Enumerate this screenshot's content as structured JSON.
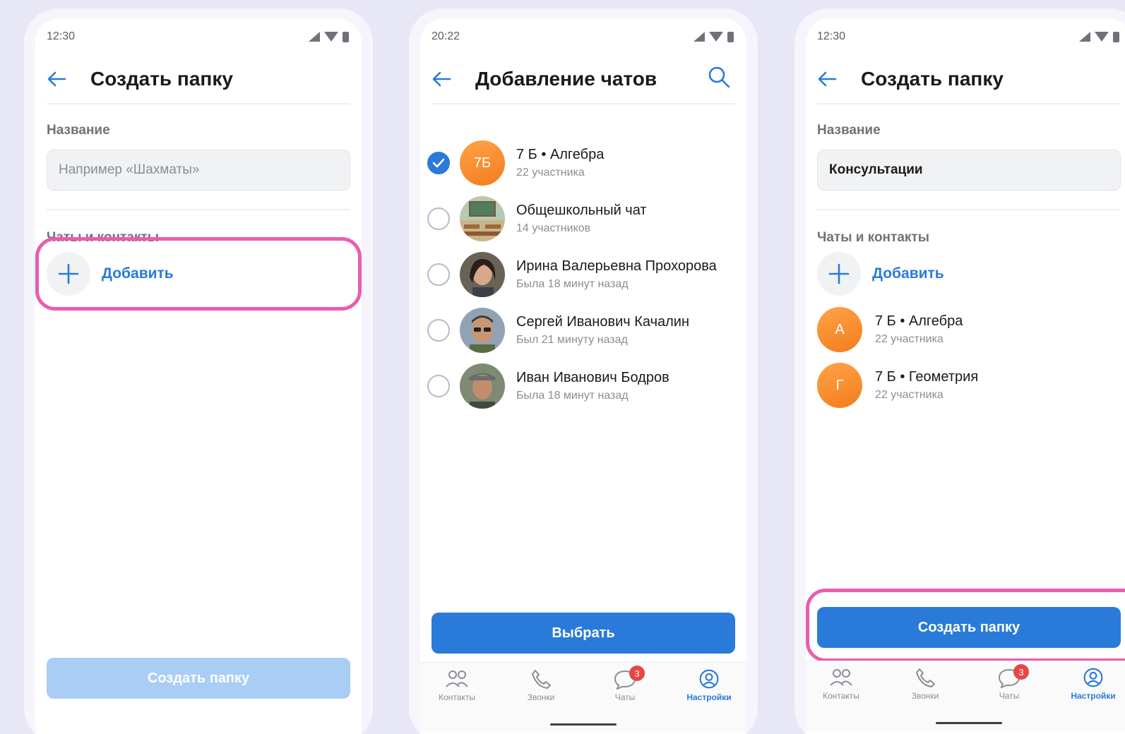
{
  "phone1": {
    "time": "12:30",
    "title": "Создать папку",
    "name_label": "Название",
    "name_placeholder": "Например «Шахматы»",
    "chats_label": "Чаты и контакты",
    "add_label": "Добавить",
    "create_button": "Создать папку"
  },
  "phone2": {
    "time": "20:22",
    "title": "Добавление чатов",
    "chats": [
      {
        "name": "7 Б • Алгебра",
        "sub": "22 участника",
        "avatar_text": "7Б",
        "checked": true
      },
      {
        "name": "Общешкольный чат",
        "sub": "14 участников",
        "checked": false
      },
      {
        "name": "Ирина Валерьевна Прохорова",
        "sub": "Была 18 минут назад",
        "checked": false
      },
      {
        "name": "Сергей Иванович Качалин",
        "sub": "Был 21 минуту назад",
        "checked": false
      },
      {
        "name": "Иван Иванович Бодров",
        "sub": "Была 18 минут назад",
        "checked": false
      }
    ],
    "select_button": "Выбрать",
    "tabs": [
      {
        "label": "Контакты",
        "icon": "contacts-icon"
      },
      {
        "label": "Звонки",
        "icon": "phone-icon"
      },
      {
        "label": "Чаты",
        "icon": "chat-icon",
        "badge": "3"
      },
      {
        "label": "Настройки",
        "icon": "settings-icon",
        "active": true
      }
    ]
  },
  "phone3": {
    "time": "12:30",
    "title": "Создать папку",
    "name_label": "Название",
    "name_value": "Консультации",
    "chats_label": "Чаты и контакты",
    "add_label": "Добавить",
    "folder_chats": [
      {
        "name": "7 Б • Алгебра",
        "sub": "22 участника",
        "avatar_text": "А"
      },
      {
        "name": "7 Б • Геометрия",
        "sub": "22 участника",
        "avatar_text": "Г"
      }
    ],
    "create_button": "Создать папку",
    "tabs": [
      {
        "label": "Контакты",
        "icon": "contacts-icon"
      },
      {
        "label": "Звонки",
        "icon": "phone-icon"
      },
      {
        "label": "Чаты",
        "icon": "chat-icon",
        "badge": "3"
      },
      {
        "label": "Настройки",
        "icon": "settings-icon",
        "active": true
      }
    ]
  },
  "colors": {
    "accent": "#2a7ad9",
    "accent_disabled": "#a9cdf5",
    "highlight": "#e85db0",
    "avatar_orange": "#f58a2a",
    "badge": "#e64646"
  }
}
